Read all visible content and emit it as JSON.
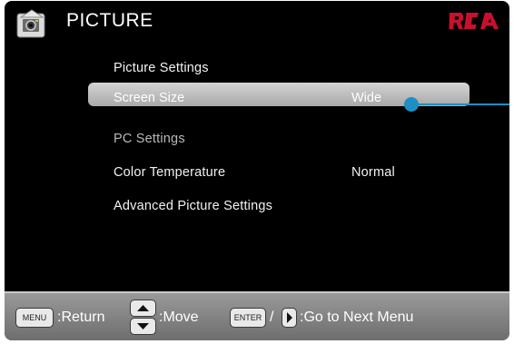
{
  "header": {
    "title": "PICTURE",
    "icon": "picture-settings-icon",
    "brand": "RCA",
    "brand_color": "#c8102e"
  },
  "menu": {
    "items": [
      {
        "label": "Picture Settings",
        "value": "",
        "state": "enabled"
      },
      {
        "label": "Screen Size",
        "value": "Wide",
        "state": "selected"
      },
      {
        "label": "PC Settings",
        "value": "",
        "state": "disabled"
      },
      {
        "label": "Color Temperature",
        "value": "Normal",
        "state": "enabled"
      },
      {
        "label": "Advanced Picture Settings",
        "value": "",
        "state": "enabled"
      }
    ]
  },
  "footer": {
    "menu_key": "MENU",
    "return_label": ":Return",
    "move_label": ":Move",
    "enter_key": "ENTER",
    "separator": "/",
    "next_label": ":Go to Next Menu"
  },
  "colors": {
    "background": "#000000",
    "highlight": "#bfbfbf",
    "accent": "#1e8fc4",
    "footer": "#858585"
  }
}
